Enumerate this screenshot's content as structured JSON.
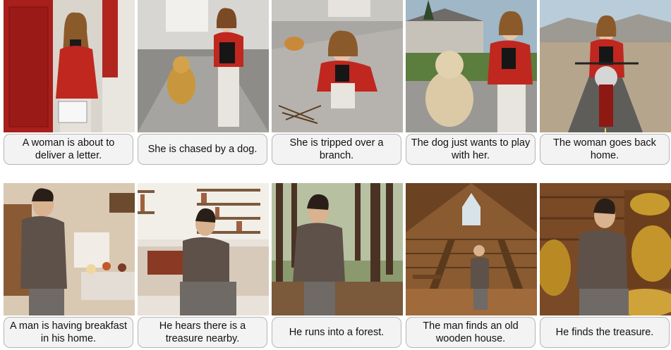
{
  "stories": [
    {
      "panels": [
        {
          "caption": "A woman is about to deliver a letter.",
          "scene": "doorway"
        },
        {
          "caption": "She is chased by a dog.",
          "scene": "street-dog"
        },
        {
          "caption": "She is tripped over a branch.",
          "scene": "sidewalk-fall"
        },
        {
          "caption": "The dog just wants to play with her.",
          "scene": "yard-dog"
        },
        {
          "caption": "The woman goes back home.",
          "scene": "road-motorcycle"
        }
      ]
    },
    {
      "panels": [
        {
          "caption": "A man is having breakfast in his home.",
          "scene": "kitchen"
        },
        {
          "caption": "He hears there is a treasure nearby.",
          "scene": "living-room"
        },
        {
          "caption": "He runs into a forest.",
          "scene": "forest"
        },
        {
          "caption": "The man finds an old wooden house.",
          "scene": "wooden-house"
        },
        {
          "caption": "He finds the treasure.",
          "scene": "treasure"
        }
      ]
    }
  ]
}
